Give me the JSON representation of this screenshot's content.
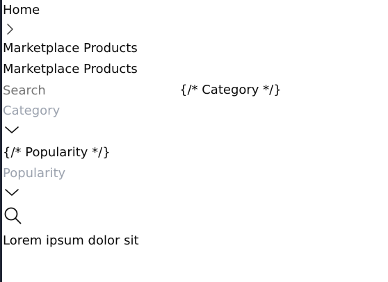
{
  "breadcrumb": {
    "home_label": "Home",
    "current_label": "Marketplace Products"
  },
  "page": {
    "title": "Marketplace Products"
  },
  "filters": {
    "search_placeholder": "Search",
    "category_comment": "{/* Category */}",
    "category_placeholder": "Category",
    "popularity_comment": "{/* Popularity */}",
    "popularity_placeholder": "Popularity"
  },
  "results": {
    "first_item": "Lorem ipsum dolor sit"
  },
  "icons": {
    "breadcrumb_separator": "chevron-right-icon",
    "category_dropdown": "chevron-down-icon",
    "popularity_dropdown": "chevron-down-icon",
    "search": "search-icon"
  },
  "colors": {
    "text": "#0a0a0a",
    "placeholder": "#9ca3af",
    "left_border": "#1f2433",
    "icon_stroke": "#111111"
  }
}
